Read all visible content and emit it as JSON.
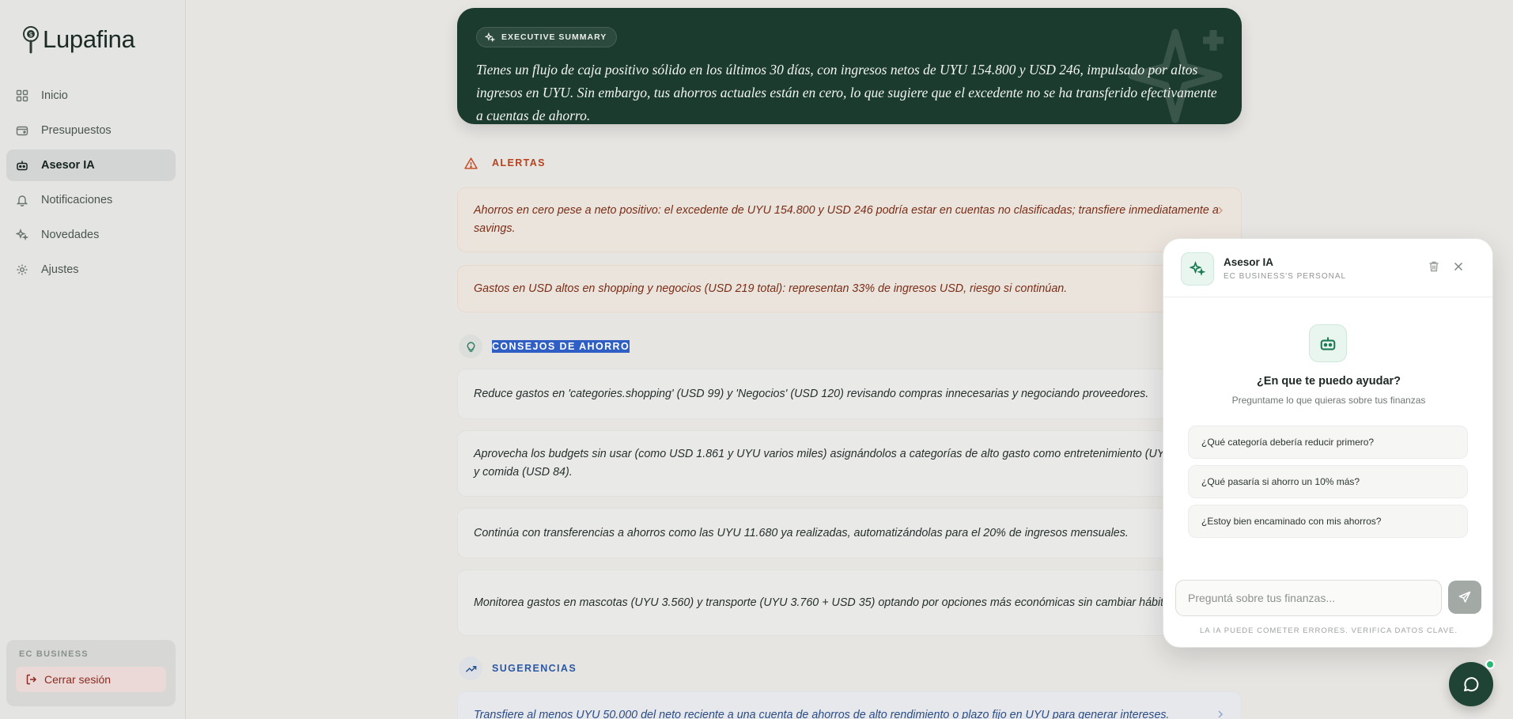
{
  "app": {
    "name": "Lupafina"
  },
  "sidebar": {
    "items": [
      {
        "label": "Inicio",
        "icon": "grid-icon"
      },
      {
        "label": "Presupuestos",
        "icon": "wallet-icon"
      },
      {
        "label": "Asesor IA",
        "icon": "robot-icon",
        "active": true
      },
      {
        "label": "Notificaciones",
        "icon": "bell-icon"
      },
      {
        "label": "Novedades",
        "icon": "sparkles-icon"
      },
      {
        "label": "Ajustes",
        "icon": "gear-icon"
      }
    ],
    "account_name": "EC BUSINESS",
    "logout_label": "Cerrar sesión"
  },
  "summary": {
    "badge": "EXECUTIVE SUMMARY",
    "text": "Tienes un flujo de caja positivo sólido en los últimos 30 días, con ingresos netos de UYU 154.800 y USD 246, impulsado por altos ingresos en UYU. Sin embargo, tus ahorros actuales están en cero, lo que sugiere que el excedente no se ha transferido efectivamente a cuentas de ahorro."
  },
  "alerts": {
    "title": "ALERTAS",
    "items": [
      "Ahorros en cero pese a neto positivo: el excedente de UYU 154.800 y USD 246 podría estar en cuentas no clasificadas; transfiere inmediatamente a savings.",
      "Gastos en USD altos en shopping y negocios (USD 219 total): representan 33% de ingresos USD, riesgo si continúan."
    ]
  },
  "tips": {
    "title": "CONSEJOS DE AHORRO",
    "items": [
      "Reduce gastos en 'categories.shopping' (USD 99) y 'Negocios' (USD 120) revisando compras innecesarias y negociando proveedores.",
      "Aprovecha los budgets sin usar (como USD 1.861 y UYU varios miles) asignándolos a categorías de alto gasto como entretenimiento (UYU USD 50) y comida (USD 84).",
      "Continúa con transferencias a ahorros como las UYU 11.680 ya realizadas, automatizándolas para el 20% de ingresos mensuales.",
      "Monitorea gastos en mascotas (UYU 3.560) y transporte (UYU 3.760 + USD 35) optando por opciones más económicas sin cambiar hábito. mayores."
    ]
  },
  "suggestions": {
    "title": "SUGERENCIAS",
    "items": [
      "Transfiere al menos UYU 50.000 del neto reciente a una cuenta de ahorros de alto rendimiento o plazo fijo en UYU para generar intereses."
    ]
  },
  "chat": {
    "title": "Asesor IA",
    "subtitle": "EC BUSINESS'S PERSONAL",
    "question": "¿En que te puedo ayudar?",
    "hint": "Preguntame lo que quieras sobre tus finanzas",
    "suggestions": [
      "¿Qué categoría debería reducir primero?",
      "¿Qué pasaría si ahorro un 10% más?",
      "¿Estoy bien encaminado con mis ahorros?"
    ],
    "input_placeholder": "Preguntá sobre tus finanzas...",
    "disclaimer": "LA IA PUEDE COMETER ERRORES. VERIFICA DATOS CLAVE."
  },
  "colors": {
    "brand_dark": "#1c3b2f",
    "alert": "#b5431e",
    "tips": "#2e7d5e",
    "suggestions": "#2b58a3"
  }
}
